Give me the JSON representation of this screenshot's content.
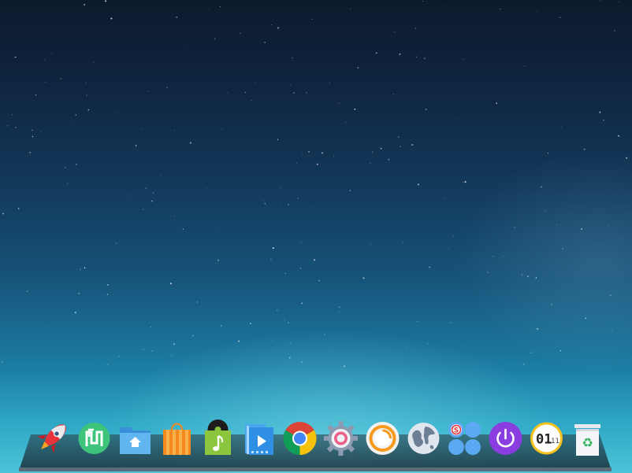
{
  "desktop": {
    "wallpaper": "starry-night-blue-gradient"
  },
  "dock": {
    "items": [
      {
        "name": "launcher",
        "icon": "rocket-icon"
      },
      {
        "name": "deepin-store",
        "icon": "store-bag-icon"
      },
      {
        "name": "file-manager",
        "icon": "folder-home-icon"
      },
      {
        "name": "app-store",
        "icon": "shopping-bag-icon"
      },
      {
        "name": "music-player",
        "icon": "music-note-icon"
      },
      {
        "name": "video-player",
        "icon": "movie-player-icon"
      },
      {
        "name": "chrome",
        "icon": "chrome-icon"
      },
      {
        "name": "control-center",
        "icon": "gear-icon"
      },
      {
        "name": "screen-recorder",
        "icon": "camera-lens-icon"
      },
      {
        "name": "browser",
        "icon": "globe-icon"
      },
      {
        "name": "system-monitor",
        "icon": "sogou-input-icon"
      },
      {
        "name": "shutdown",
        "icon": "power-icon"
      },
      {
        "name": "clock",
        "icon": "clock-icon",
        "time_hour": "01",
        "time_minute": "11"
      },
      {
        "name": "trash",
        "icon": "trash-icon",
        "symbol": "♻"
      }
    ]
  },
  "colors": {
    "rocket": "#e8333a",
    "store_green": "#3ec47a",
    "folder_blue": "#5ab3ee",
    "bag_orange": "#f48a1d",
    "music_green": "#8cc63f",
    "video_blue": "#2f8fe5",
    "power_purple": "#8a3ee0",
    "clock_yellow": "#f6c31e",
    "recorder_orange": "#f79a1c"
  }
}
